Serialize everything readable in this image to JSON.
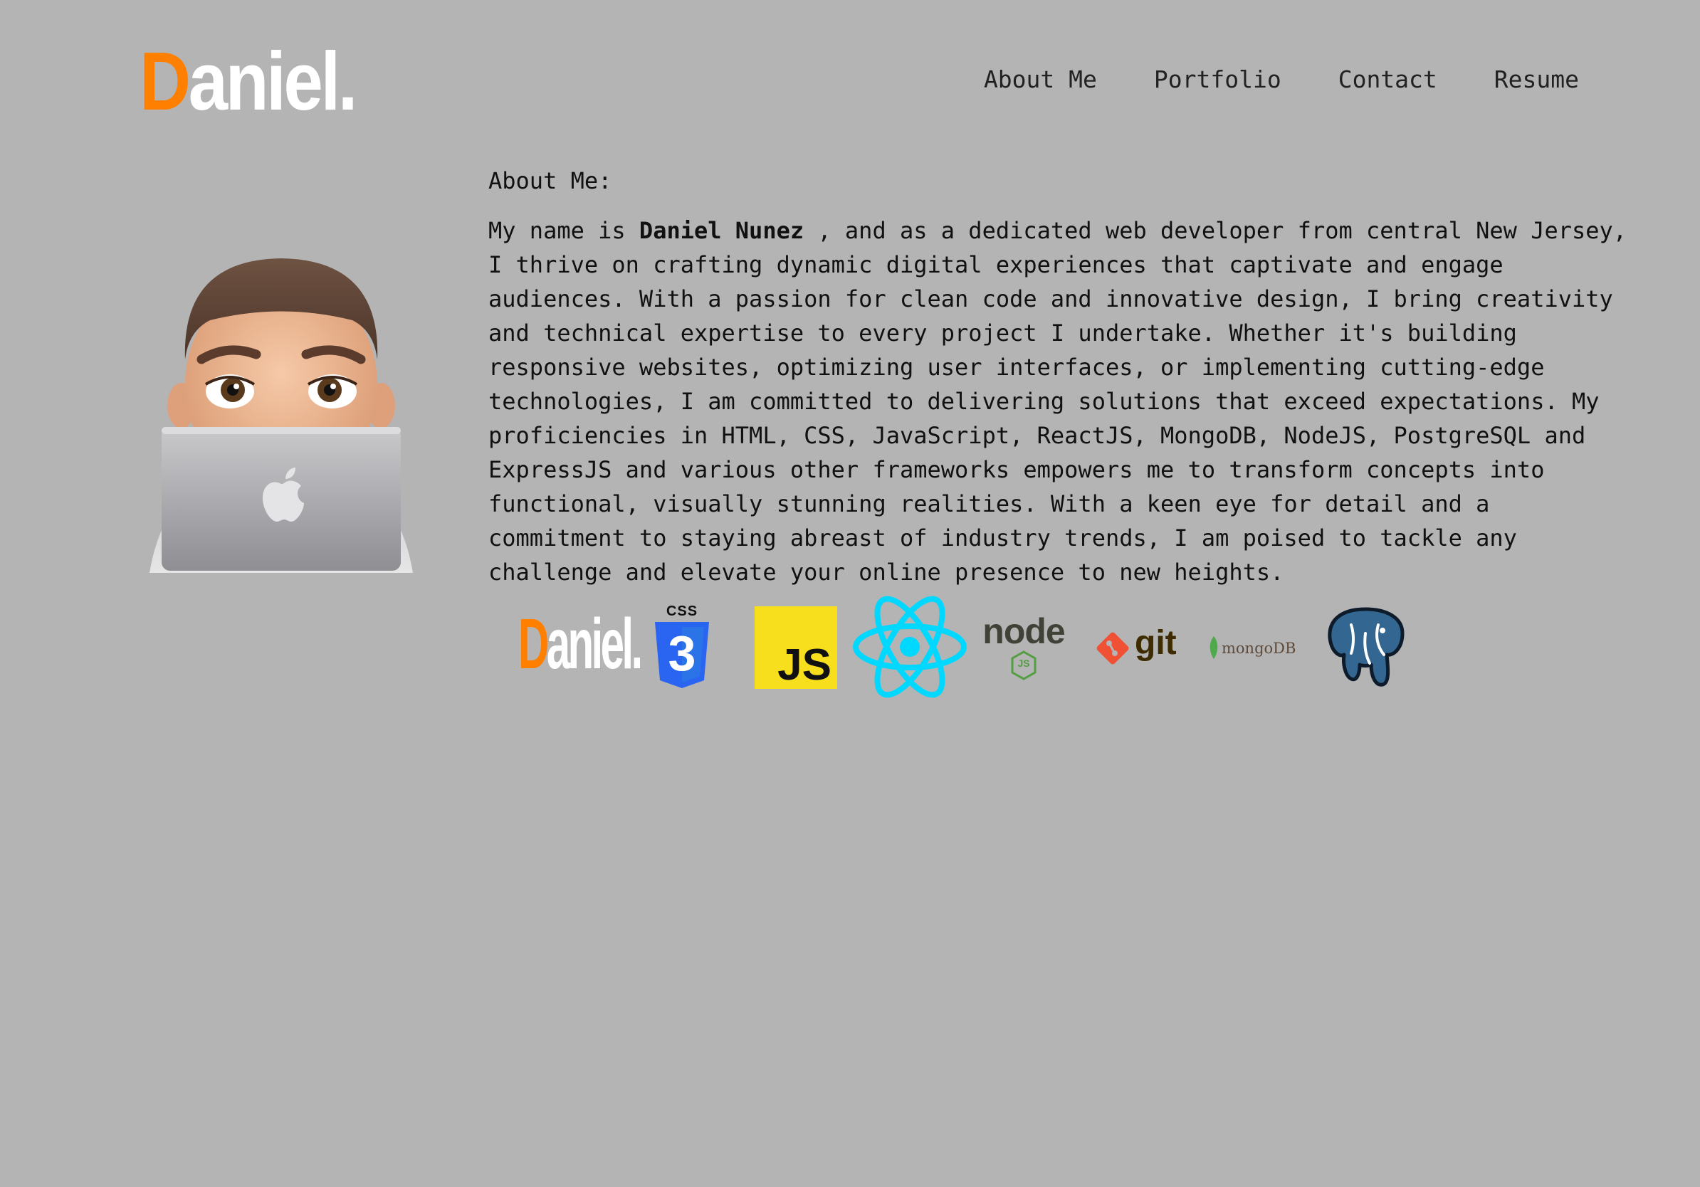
{
  "header": {
    "logo_initial": "D",
    "logo_rest": "aniel.",
    "nav": [
      {
        "label": "About Me"
      },
      {
        "label": "Portfolio"
      },
      {
        "label": "Contact"
      },
      {
        "label": "Resume"
      }
    ]
  },
  "about": {
    "heading": "About Me:",
    "intro_before": "My name is ",
    "name": "Daniel Nunez",
    "text_after": " , and as a dedicated web developer from central New Jersey, I thrive on crafting dynamic digital experiences that captivate and engage audiences. With a passion for clean code and innovative design, I bring creativity and technical expertise to every project I undertake. Whether it's building responsive websites, optimizing user interfaces, or implementing cutting-edge technologies, I am committed to delivering solutions that exceed expectations. My proficiencies in HTML, CSS, JavaScript, ReactJS, MongoDB, NodeJS, PostgreSQL and ExpressJS and various other frameworks empowers me to transform concepts into functional, visually stunning realities. With a keen eye for detail and a commitment to staying abreast of industry trends, I am poised to tackle any challenge and elevate your online presence to new heights."
  },
  "tech_icons": {
    "logo_initial": "D",
    "logo_rest": "aniel.",
    "css_label": "CSS",
    "css_number": "3",
    "js_label": "JS",
    "node_label": "node",
    "node_badge": "JS",
    "git_label": "git",
    "mongo_label": "mongoDB"
  },
  "colors": {
    "background": "#b4b4b4",
    "accent_orange": "#ff7f00",
    "css_blue": "#2965f1",
    "js_yellow": "#f7df1e",
    "react_cyan": "#00d8ff",
    "node_green": "#539e43",
    "git_red": "#f05033",
    "mongo_green": "#4fa94d",
    "postgres_blue": "#336791"
  }
}
